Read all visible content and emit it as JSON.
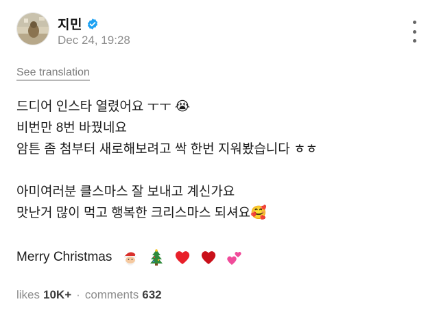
{
  "post": {
    "username": "지민",
    "timestamp": "Dec 24, 19:28",
    "see_translation": "See translation",
    "lines": [
      "드디어 인스타 열렸어요 ㅜㅜ 😭",
      "비번만 8번 바꿨네요",
      "암튼 좀 첨부터 새로해보려고 싹 한번 지워봤습니다 ㅎㅎ",
      "",
      "아미여러분 클스마스 잘 보내고 계신가요",
      "맛난거 많이 먹고 행복한 크리스마스 되셔요🥰",
      ""
    ],
    "closing": "Merry Christmas",
    "closing_emojis": [
      "santa-icon",
      "christmas-tree-icon",
      "red-heart-icon",
      "dark-red-heart-icon",
      "two-hearts-icon"
    ]
  },
  "stats": {
    "likes_label": "likes",
    "likes_value": "10K+",
    "separator": "·",
    "comments_label": "comments",
    "comments_value": "632"
  },
  "colors": {
    "verified": "#1DA1F2",
    "muted": "#8c8c8c",
    "text": "#1c1c1c"
  }
}
